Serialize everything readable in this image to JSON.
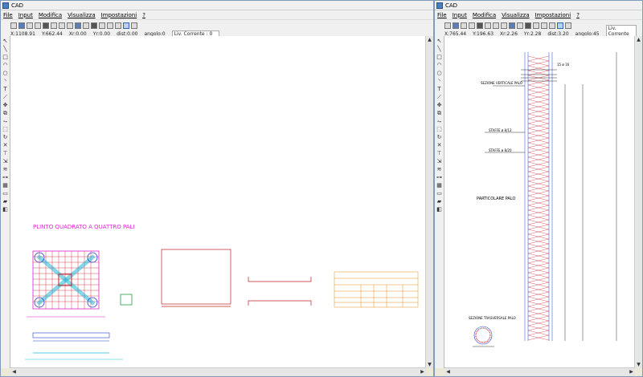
{
  "windows": [
    {
      "title": "CAD",
      "menu": [
        "File",
        "Input",
        "Modifica",
        "Visualizza",
        "Impostazioni",
        "?"
      ],
      "coords": {
        "x": "X:1108.91",
        "y": "Y:662.44",
        "xr": "Xr:0.00",
        "yr": "Yr:0.00",
        "dist": "dist:0.00",
        "angolo": "angolo:0",
        "liv": "Liv. Corrente : 0"
      },
      "drawing": {
        "title": "PLINTO QUADRATO A QUATTRO PALI"
      }
    },
    {
      "title": "CAD",
      "menu": [
        "File",
        "Input",
        "Modifica",
        "Visualizza",
        "Impostazioni",
        "?"
      ],
      "coords": {
        "x": "X:765.44",
        "y": "Y:196.63",
        "xr": "Xr:2.26",
        "yr": "Yr:2.28",
        "dist": "dist:3.20",
        "angolo": "angolo:45",
        "liv": "Liv. Corrente : 0"
      },
      "drawing": {
        "label_vertical": "SEZIONE VERTICALE PALO",
        "label_staffe1": "STAFFE ø 8/12",
        "label_staffe2": "STAFFE ø 8/20",
        "label_particolare": "PARTICOLARE  PALO",
        "label_trasversale": "SEZIONE TRASVERSALE PALO",
        "label_rebar": "15 ø 16"
      }
    }
  ],
  "colors": {
    "magenta": "#e020d0",
    "red": "#c0202a",
    "cyan": "#20b8d8",
    "blue": "#2040d0",
    "orange": "#e09020",
    "green": "#20a040"
  }
}
